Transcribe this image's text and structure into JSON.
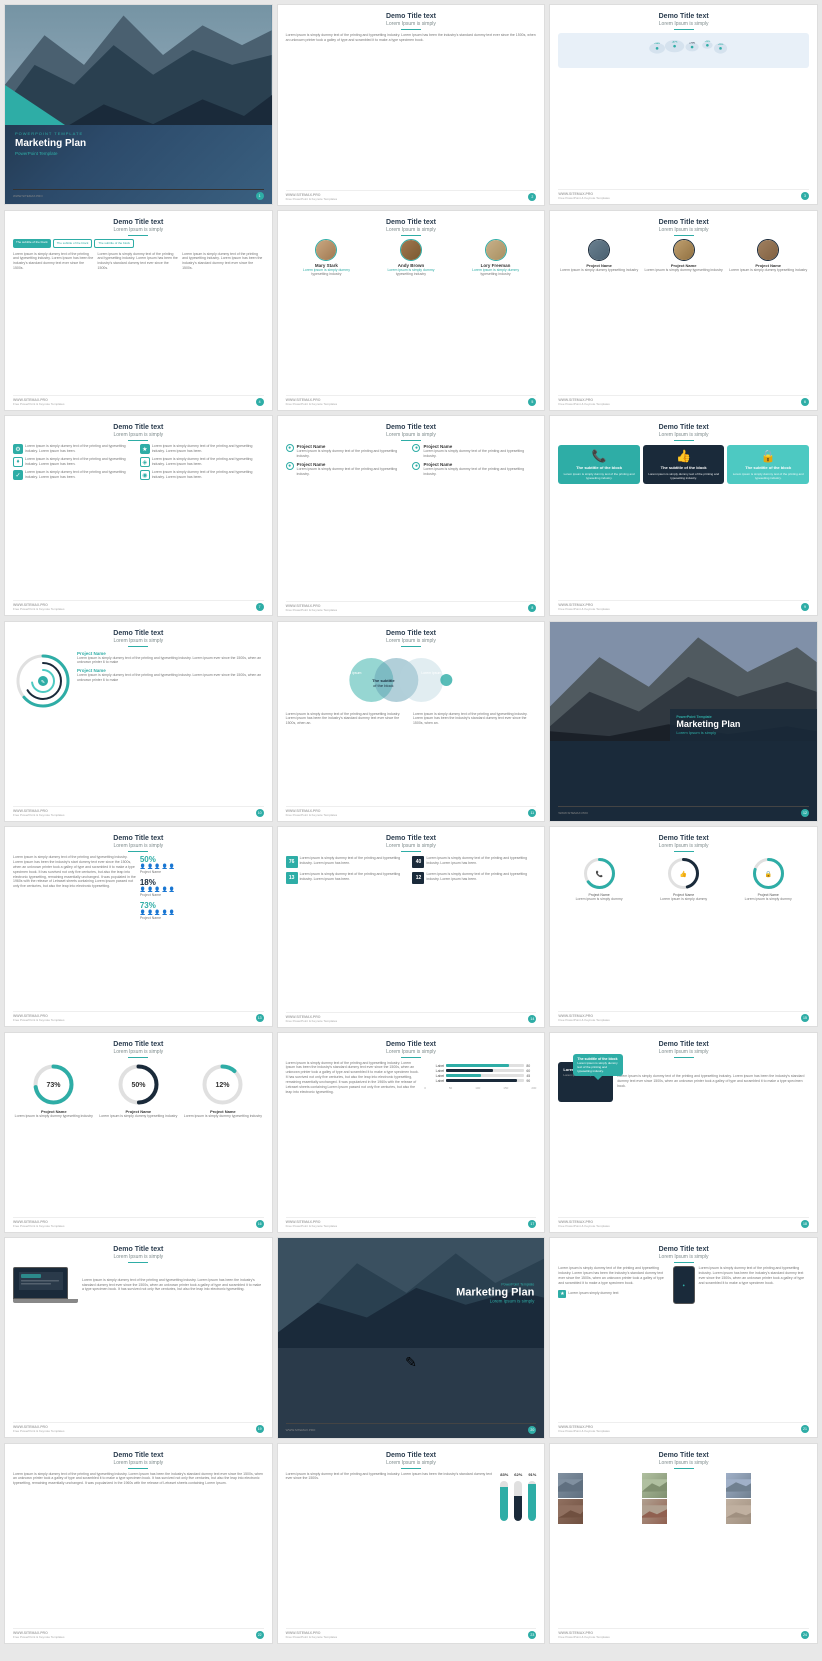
{
  "site": {
    "url": "WWW.SITEMAX.PRO",
    "tagline": "Free PowerPoint & Keynote Templates"
  },
  "template": {
    "name": "Marketing Plan",
    "type": "PowerPoint Template"
  },
  "slides": [
    {
      "id": 1,
      "type": "cover",
      "title": "Marketing Plan",
      "subtitle": "PowerPoint Template"
    },
    {
      "id": 2,
      "type": "title-text-wide",
      "title": "Demo Title text",
      "subtitle": "Lorem Ipsum is simply",
      "body": "Lorem ipsum is simply dummy text of the printing and typesetting industry. Lorem Ipsum has been the industry's standard dummy text ever since the 1500s, when an unknown printer took a galley of type and scrambled it to make a type specimen book."
    },
    {
      "id": 3,
      "type": "world-map",
      "title": "Demo Title text",
      "subtitle": "Lorem Ipsum is simply",
      "stats": [
        "+98%",
        "+47%",
        "+71%",
        "+12%",
        "+15%"
      ]
    },
    {
      "id": 4,
      "type": "tabs-text",
      "title": "Demo Title text",
      "subtitle": "Lorem Ipsum is simply",
      "tabs": [
        "The subtitle of the block",
        "The subtitle of the block",
        "The subtitle of the block"
      ]
    },
    {
      "id": 5,
      "type": "team",
      "title": "Demo Title text",
      "subtitle": "Lorem Ipsum is simply",
      "members": [
        {
          "name": "Mary Stark",
          "role": "Lorem ipsum is simply dummy typesetting industry"
        },
        {
          "name": "Andy Brown",
          "role": "Lorem ipsum is simply dummy typesetting industry"
        },
        {
          "name": "Lory Freeman",
          "role": "Lorem ipsum is simply dummy typesetting industry"
        }
      ]
    },
    {
      "id": 6,
      "type": "team-dark",
      "title": "Demo Title text",
      "subtitle": "Lorem Ipsum is simply",
      "members": [
        {
          "name": "Project Name",
          "role": "Lorem ipsum is simply dummy typesetting industry"
        },
        {
          "name": "Project Name",
          "role": "Lorem ipsum is simply dummy typesetting industry"
        },
        {
          "name": "Project Name",
          "role": "Lorem ipsum is simply dummy typesetting industry"
        }
      ]
    },
    {
      "id": 7,
      "type": "icon-list",
      "title": "Demo Title text",
      "subtitle": "Lorem Ipsum is simply",
      "items": [
        "Lorem ipsum is simply dummy text of the printing and typesetting industry. Lorem ipsum has been.",
        "Lorem ipsum is simply dummy text of the printing and typesetting industry. Lorem ipsum has been.",
        "Lorem ipsum is simply dummy text of the printing and typesetting industry. Lorem ipsum has been.",
        "Lorem ipsum is simply dummy text of the printing and typesetting industry. Lorem ipsum has been.",
        "Lorem ipsum is simply dummy text of the printing and typesetting industry. Lorem ipsum has been.",
        "Lorem ipsum is simply dummy text of the printing and typesetting industry. Lorem ipsum has been."
      ]
    },
    {
      "id": 8,
      "type": "project-cols",
      "title": "Demo Title text",
      "subtitle": "Lorem Ipsum is simply",
      "projects": [
        {
          "name": "Project Name",
          "text": "Lorem ipsum is simply dummy text of the printing and typesetting industry."
        },
        {
          "name": "Project Name",
          "text": "Lorem ipsum is simply dummy text of the printing and typesetting industry."
        },
        {
          "name": "Project Name",
          "text": "Lorem ipsum is simply dummy text of the printing and typesetting industry."
        },
        {
          "name": "Project Name",
          "text": "Lorem ipsum is simply dummy text of the printing and typesetting industry."
        }
      ]
    },
    {
      "id": 9,
      "type": "cards",
      "title": "Demo Title text",
      "subtitle": "Lorem Ipsum is simply",
      "cards": [
        {
          "title": "The subtitle of the block",
          "text": "Lorem ipsum is simply dummy text..."
        },
        {
          "title": "The subtitle of the block",
          "text": "Lorem ipsum is simply dummy text..."
        },
        {
          "title": "The subtitle of the block",
          "text": "Lorem ipsum is simply dummy text..."
        }
      ]
    },
    {
      "id": 10,
      "type": "radial",
      "title": "Demo Title text",
      "subtitle": "Lorem Ipsum is simply",
      "project1": "Project Name",
      "project2": "Project Name"
    },
    {
      "id": 11,
      "type": "venn",
      "title": "Demo Title text",
      "subtitle": "Lorem Ipsum is simply",
      "center_label": "The subtitle of the block"
    },
    {
      "id": 12,
      "type": "mountain-cover",
      "title": "Marketing Plan",
      "subtitle": "Lorem Ipsum is simply",
      "type_label": "PowerPoint Template"
    },
    {
      "id": 13,
      "type": "stats-people",
      "title": "Demo Title text",
      "subtitle": "Lorem Ipsum is simply",
      "stats": [
        {
          "value": "50%",
          "label": "Project Name"
        },
        {
          "value": "18%",
          "label": "Project Name"
        },
        {
          "value": "73%",
          "label": "Project Name"
        }
      ]
    },
    {
      "id": 14,
      "type": "numbered-list",
      "title": "Demo Title text",
      "subtitle": "Lorem Ipsum is simply",
      "items": [
        {
          "num": "76",
          "text": "Lorem ipsum is simply dummy text of the printing and typesetting industry."
        },
        {
          "num": "40",
          "text": "Lorem ipsum is simply dummy text of the printing and typesetting industry."
        },
        {
          "num": "13",
          "text": "Lorem ipsum is simply dummy text of the printing and typesetting industry."
        },
        {
          "num": "12",
          "text": "Lorem ipsum is simply dummy text of the printing and typesetting industry."
        }
      ]
    },
    {
      "id": 15,
      "type": "donut-icons",
      "title": "Demo Title text",
      "subtitle": "Lorem Ipsum is simply",
      "donuts": [
        {
          "label": "Project Name",
          "value": 65
        },
        {
          "label": "Project Name",
          "value": 45
        },
        {
          "label": "Project Name",
          "value": 80
        }
      ]
    },
    {
      "id": 16,
      "type": "large-donuts",
      "title": "Demo Title text",
      "subtitle": "Lorem Ipsum is simply",
      "donuts": [
        {
          "label": "Project Name",
          "value": 73,
          "display": "73%"
        },
        {
          "label": "Project Name",
          "value": 50,
          "display": "50%"
        },
        {
          "label": "Project Name",
          "value": 12,
          "display": "12%"
        }
      ]
    },
    {
      "id": 17,
      "type": "text-bars",
      "title": "Demo Title text",
      "subtitle": "Lorem Ipsum is simply",
      "body": "Lorem ipsum is simply dummy text of the printing and typesetting industry. Lorem Ipsum has been the industry's standard dummy text ever since the 1500s.",
      "bars": [
        {
          "label": "Label",
          "value": 80
        },
        {
          "label": "Label",
          "value": 60
        },
        {
          "label": "Label",
          "value": 45
        },
        {
          "label": "Label",
          "value": 90
        }
      ]
    },
    {
      "id": 18,
      "type": "device-text",
      "title": "Demo Title text",
      "subtitle": "Lorem Ipsum is simply",
      "bubble_text": "The subtitle of the block",
      "body": "Lorem ipsum is simply dummy text of the printing and typesetting industry."
    },
    {
      "id": 19,
      "type": "laptop-text",
      "title": "Demo Title text",
      "subtitle": "Lorem Ipsum is simply",
      "body": "Lorem ipsum is simply dummy text of the printing and typesetting industry. Lorem Ipsum has been the industry's standard dummy text ever since the 1500s."
    },
    {
      "id": 20,
      "type": "marketing-cover-2",
      "title": "Marketing Plan",
      "subtitle": "Lorem Ipsum is simply"
    },
    {
      "id": 21,
      "type": "phone-text",
      "title": "Demo Title text",
      "subtitle": "Lorem Ipsum is simply",
      "body_left": "Lorem ipsum is simply dummy text of the printing and typesetting industry.",
      "body_right": "Lorem ipsum is simply dummy text of the printing and typesetting industry."
    },
    {
      "id": 22,
      "type": "long-text",
      "title": "Demo Title text",
      "subtitle": "Lorem Ipsum is simply",
      "body": "Lorem ipsum is simply dummy text of the printing and typesetting industry. Lorem Ipsum has been the industry's standard dummy text ever since the 1500s, when an unknown printer took a galley of type and scrambled it to make a type specimen book. It has survived not only five centuries, but also the leap into electronic typesetting, remaining essentially unchanged. It was popularized in the 1960s with the release of Letraset sheets containing Lorem Ipsum."
    },
    {
      "id": 23,
      "type": "thermometer",
      "title": "Demo Title text",
      "subtitle": "Lorem Ipsum is simply",
      "body": "Lorem ipsum is simply dummy text of the printing and typesetting industry.",
      "thermos": [
        {
          "value": 83,
          "label": "83%"
        },
        {
          "value": 62,
          "label": "62%"
        },
        {
          "value": 91,
          "label": "91%"
        }
      ]
    },
    {
      "id": 24,
      "type": "photo-grid",
      "title": "Demo Title text",
      "subtitle": "Lorem Ipsum is simply"
    }
  ]
}
